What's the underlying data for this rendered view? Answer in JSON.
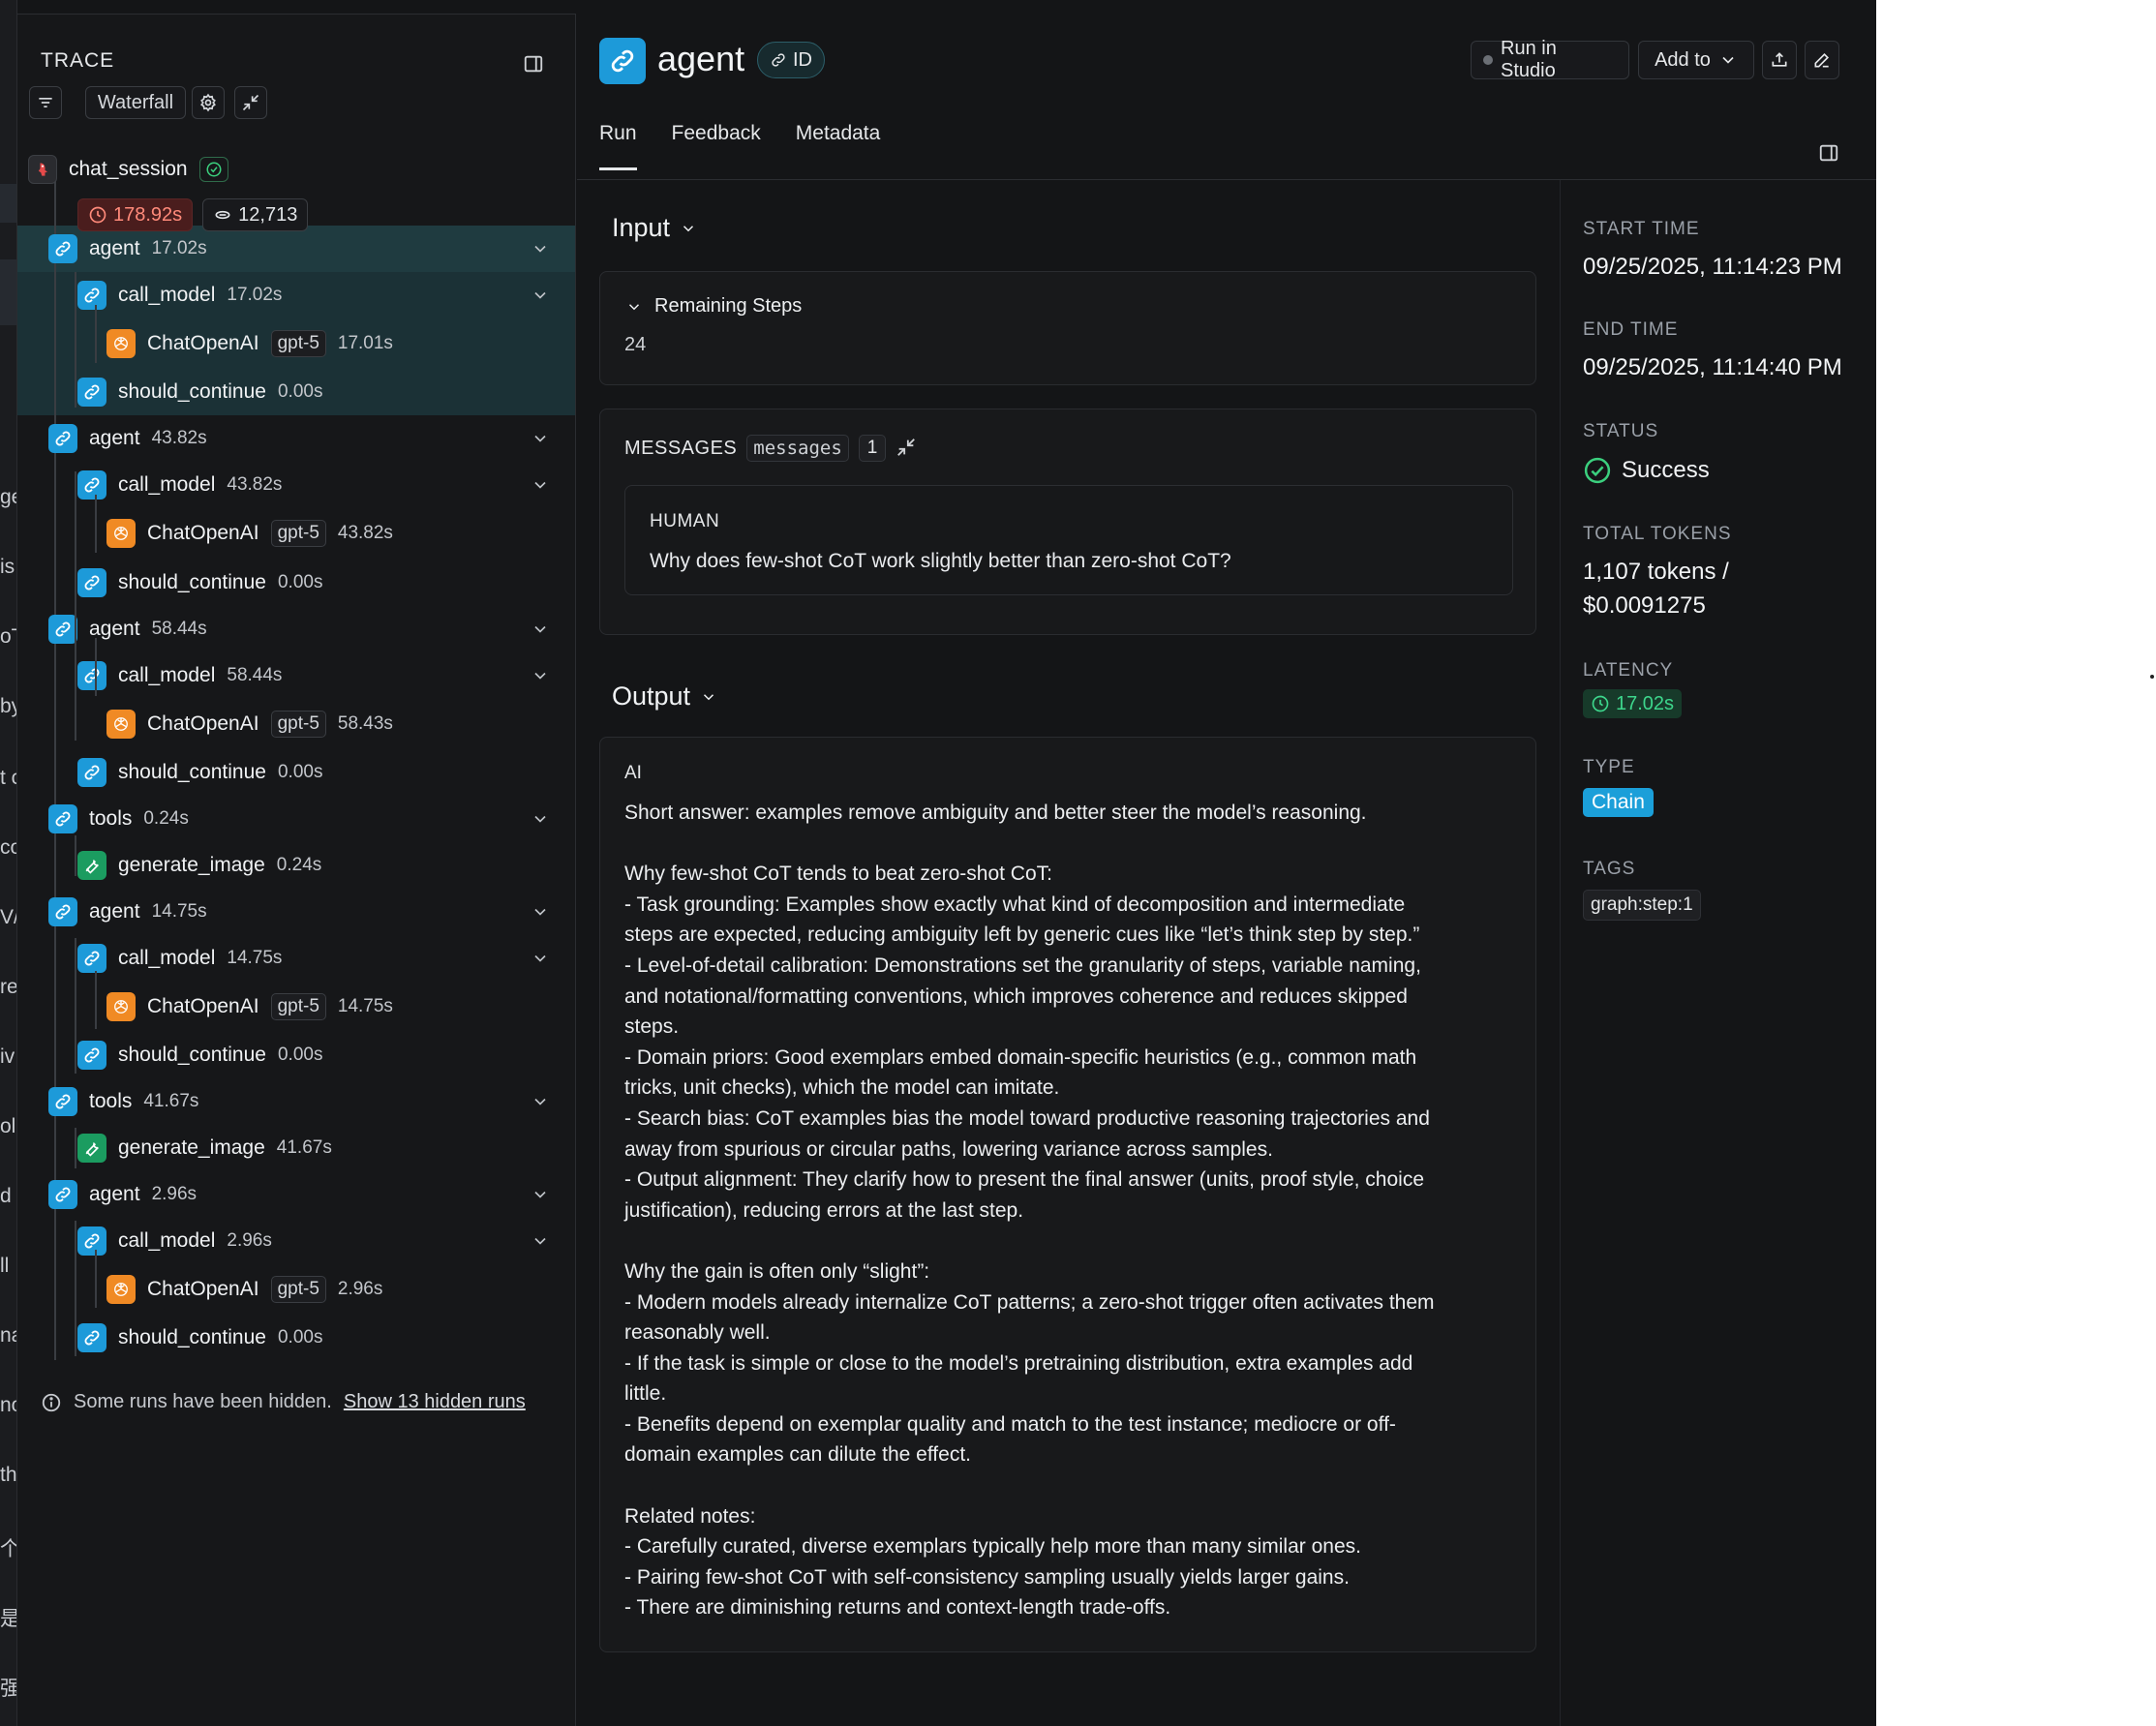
{
  "background_fragments": [
    "ge",
    "is",
    "oT",
    "by",
    "t c",
    "co",
    "V/c",
    "re",
    "iv",
    "olc",
    "d",
    "ll",
    "na",
    "no",
    "th",
    "个。",
    "是",
    "强"
  ],
  "trace": {
    "title": "TRACE",
    "view_mode": "Waterfall",
    "root": {
      "name": "chat_session",
      "duration": "178.92s",
      "tokens": "12,713",
      "status": "success"
    },
    "nodes": [
      {
        "type": "chain",
        "name": "agent",
        "duration": "17.02s",
        "depth": 1,
        "expand": true,
        "selected": true
      },
      {
        "type": "chain",
        "name": "call_model",
        "duration": "17.02s",
        "depth": 2,
        "expand": true
      },
      {
        "type": "llm",
        "name": "ChatOpenAI",
        "model": "gpt-5",
        "duration": "17.01s",
        "depth": 3
      },
      {
        "type": "chain",
        "name": "should_continue",
        "duration": "0.00s",
        "depth": 2
      },
      {
        "type": "chain",
        "name": "agent",
        "duration": "43.82s",
        "depth": 1,
        "expand": true
      },
      {
        "type": "chain",
        "name": "call_model",
        "duration": "43.82s",
        "depth": 2,
        "expand": true
      },
      {
        "type": "llm",
        "name": "ChatOpenAI",
        "model": "gpt-5",
        "duration": "43.82s",
        "depth": 3
      },
      {
        "type": "chain",
        "name": "should_continue",
        "duration": "0.00s",
        "depth": 2
      },
      {
        "type": "chain",
        "name": "agent",
        "duration": "58.44s",
        "depth": 1,
        "expand": true
      },
      {
        "type": "chain",
        "name": "call_model",
        "duration": "58.44s",
        "depth": 2,
        "expand": true
      },
      {
        "type": "llm",
        "name": "ChatOpenAI",
        "model": "gpt-5",
        "duration": "58.43s",
        "depth": 3
      },
      {
        "type": "chain",
        "name": "should_continue",
        "duration": "0.00s",
        "depth": 2
      },
      {
        "type": "chain",
        "name": "tools",
        "duration": "0.24s",
        "depth": 1,
        "expand": true
      },
      {
        "type": "tool",
        "name": "generate_image",
        "duration": "0.24s",
        "depth": 2
      },
      {
        "type": "chain",
        "name": "agent",
        "duration": "14.75s",
        "depth": 1,
        "expand": true
      },
      {
        "type": "chain",
        "name": "call_model",
        "duration": "14.75s",
        "depth": 2,
        "expand": true
      },
      {
        "type": "llm",
        "name": "ChatOpenAI",
        "model": "gpt-5",
        "duration": "14.75s",
        "depth": 3
      },
      {
        "type": "chain",
        "name": "should_continue",
        "duration": "0.00s",
        "depth": 2
      },
      {
        "type": "chain",
        "name": "tools",
        "duration": "41.67s",
        "depth": 1,
        "expand": true
      },
      {
        "type": "tool",
        "name": "generate_image",
        "duration": "41.67s",
        "depth": 2
      },
      {
        "type": "chain",
        "name": "agent",
        "duration": "2.96s",
        "depth": 1,
        "expand": true
      },
      {
        "type": "chain",
        "name": "call_model",
        "duration": "2.96s",
        "depth": 2,
        "expand": true
      },
      {
        "type": "llm",
        "name": "ChatOpenAI",
        "model": "gpt-5",
        "duration": "2.96s",
        "depth": 3
      },
      {
        "type": "chain",
        "name": "should_continue",
        "duration": "0.00s",
        "depth": 2
      }
    ],
    "hidden_note": "Some runs have been hidden.",
    "hidden_link": "Show 13 hidden runs"
  },
  "header": {
    "title": "agent",
    "id_label": "ID",
    "run_in_studio": "Run in Studio",
    "add_to": "Add to"
  },
  "tabs": [
    "Run",
    "Feedback",
    "Metadata"
  ],
  "input": {
    "heading": "Input",
    "remaining_steps_label": "Remaining Steps",
    "remaining_steps_value": "24",
    "messages_label": "MESSAGES",
    "messages_key": "messages",
    "messages_count": "1",
    "human_role": "HUMAN",
    "human_text": "Why does few-shot CoT work slightly better than zero-shot CoT?"
  },
  "output": {
    "heading": "Output",
    "ai_role": "AI",
    "ai_text": "Short answer: examples remove ambiguity and better steer the model’s reasoning.\n\nWhy few-shot CoT tends to beat zero-shot CoT:\n- Task grounding: Examples show exactly what kind of decomposition and intermediate\nsteps are expected, reducing ambiguity left by generic cues like “let’s think step by step.”\n- Level-of-detail calibration: Demonstrations set the granularity of steps, variable naming,\nand notational/formatting conventions, which improves coherence and reduces skipped\nsteps.\n- Domain priors: Good exemplars embed domain-specific heuristics (e.g., common math\ntricks, unit checks), which the model can imitate.\n- Search bias: CoT examples bias the model toward productive reasoning trajectories and\naway from spurious or circular paths, lowering variance across samples.\n- Output alignment: They clarify how to present the final answer (units, proof style, choice\njustification), reducing errors at the last step.\n\nWhy the gain is often only “slight”:\n- Modern models already internalize CoT patterns; a zero-shot trigger often activates them\nreasonably well.\n- If the task is simple or close to the model’s pretraining distribution, extra examples add\nlittle.\n- Benefits depend on exemplar quality and match to the test instance; mediocre or off-\ndomain examples can dilute the effect.\n\nRelated notes:\n- Carefully curated, diverse exemplars typically help more than many similar ones.\n- Pairing few-shot CoT with self-consistency sampling usually yields larger gains.\n- There are diminishing returns and context-length trade-offs."
  },
  "details": {
    "start_time_label": "START TIME",
    "start_time": "09/25/2025, 11:14:23 PM",
    "end_time_label": "END TIME",
    "end_time": "09/25/2025, 11:14:40 PM",
    "status_label": "STATUS",
    "status": "Success",
    "total_tokens_label": "TOTAL TOKENS",
    "total_tokens": "1,107 tokens /",
    "total_cost": "$0.0091275",
    "latency_label": "LATENCY",
    "latency": "17.02s",
    "type_label": "TYPE",
    "type": "Chain",
    "tags_label": "TAGS",
    "tag": "graph:step:1"
  },
  "colors": {
    "chain": "#1d9ad9",
    "llm": "#f08a24",
    "tool": "#1b9c60",
    "success": "#3bd07e",
    "danger": "#ff8a7a",
    "background": "#141517"
  },
  "icons": {
    "chain": "link-icon",
    "llm": "openai-icon",
    "tool": "wrench-icon",
    "root": "parrot-icon"
  }
}
